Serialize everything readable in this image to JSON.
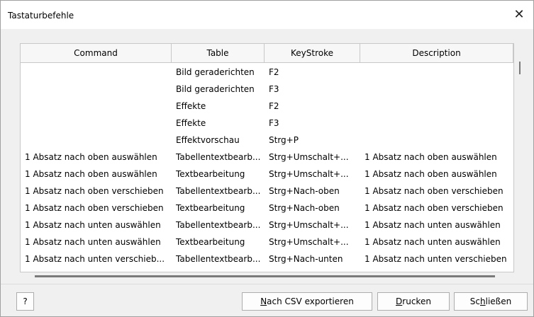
{
  "window": {
    "title": "Tastaturbefehle",
    "close_glyph": "✕"
  },
  "table": {
    "headers": [
      "Command",
      "Table",
      "KeyStroke",
      "Description"
    ],
    "rows": [
      [
        "",
        "Bild geraderichten",
        "F2",
        ""
      ],
      [
        "",
        "Bild geraderichten",
        "F3",
        ""
      ],
      [
        "",
        "Effekte",
        "F2",
        ""
      ],
      [
        "",
        "Effekte",
        "F3",
        ""
      ],
      [
        "",
        "Effektvorschau",
        "Strg+P",
        ""
      ],
      [
        "1 Absatz nach oben auswählen",
        "Tabellentextbearb...",
        "Strg+Umschalt+...",
        "1 Absatz nach oben auswählen"
      ],
      [
        "1 Absatz nach oben auswählen",
        "Textbearbeitung",
        "Strg+Umschalt+...",
        "1 Absatz nach oben auswählen"
      ],
      [
        "1 Absatz nach oben verschieben",
        "Tabellentextbearb...",
        "Strg+Nach-oben",
        "1 Absatz nach oben verschieben"
      ],
      [
        "1 Absatz nach oben verschieben",
        "Textbearbeitung",
        "Strg+Nach-oben",
        "1 Absatz nach oben verschieben"
      ],
      [
        "1 Absatz nach unten auswählen",
        "Tabellentextbearb...",
        "Strg+Umschalt+...",
        "1 Absatz nach unten auswählen"
      ],
      [
        "1 Absatz nach unten auswählen",
        "Textbearbeitung",
        "Strg+Umschalt+...",
        "1 Absatz nach unten auswählen"
      ],
      [
        "1 Absatz nach unten verschieb...",
        "Tabellentextbearb...",
        "Strg+Nach-unten",
        "1 Absatz nach unten verschieben"
      ]
    ]
  },
  "buttons": {
    "help": "?",
    "export_prefix": "N",
    "export_rest": "ach CSV exportieren",
    "print_prefix": "D",
    "print_rest": "rucken",
    "close_prefix": "Sc",
    "close_u": "h",
    "close_rest": "ließen"
  }
}
